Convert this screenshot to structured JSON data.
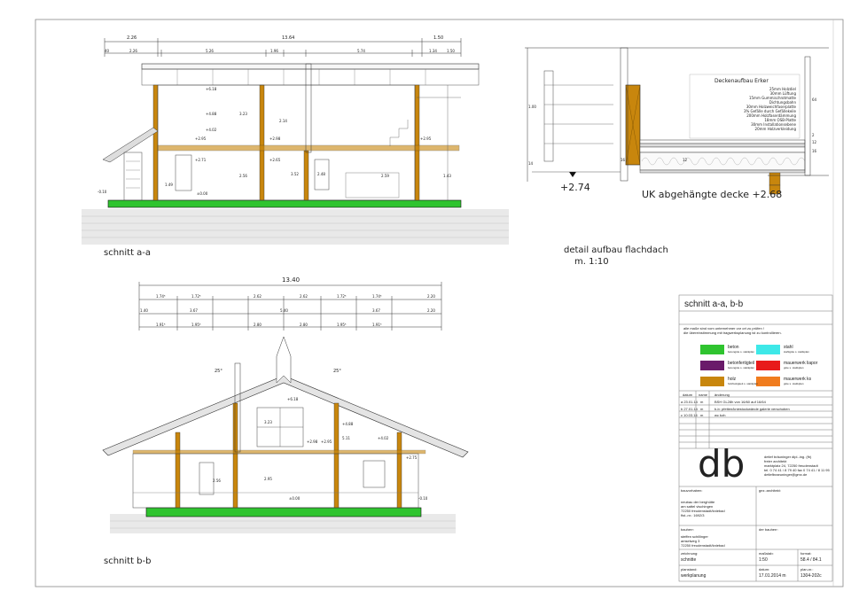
{
  "section_aa": {
    "label": "schnitt a-a",
    "dims_top": [
      "2.26",
      "13.64",
      "1.50"
    ],
    "dims_sub": [
      "40",
      "2.26",
      "16",
      "5.26",
      "16",
      "1.96",
      "16",
      "5.74",
      "16",
      "1.34",
      "16",
      "1.50"
    ],
    "levels": [
      "+6.18",
      "+4.88",
      "+4.02",
      "+2.95",
      "+2.71",
      "+2.98",
      "+2.65",
      "+2.95",
      "±0.00",
      "-0.10"
    ],
    "heights": [
      "3.23",
      "2.14",
      "2.56",
      "1.49",
      "3.52",
      "2.48",
      "2.59",
      "1.43"
    ]
  },
  "detail": {
    "label_line1": "detail aufbau flachdach",
    "label_line2": "m. 1:10",
    "elev_left": "+2.74",
    "elev_uk": "UK abgehängte decke +2.68",
    "build_up_title": "Deckenaufbau Erker",
    "build_up_lines": [
      "25mm Holzdiel",
      "30mm Lüftung",
      "15mm Gummischrotmatte",
      "Dichtungsbahn",
      "30mm Holzweichfaserplatte",
      "3% Gefälle durch Gefällekeile",
      "200mm Holzfaserdämmung",
      "18mm OSB-Platte",
      "30mm Installationsebene",
      "20mm Holzverkleidung"
    ],
    "dims": [
      "1.00",
      "64",
      "16",
      "14",
      "2",
      "12",
      "16",
      "12"
    ]
  },
  "section_bb": {
    "label": "schnitt b-b",
    "dim_total": "13.40",
    "dims_row1": [
      "16",
      "1.74⁵",
      "18",
      "1.72⁵",
      "18",
      "2.62",
      "18",
      "2.62",
      "18",
      "1.72⁵",
      "18",
      "1.74⁵",
      "16",
      "2.20"
    ],
    "dims_row2": [
      "1.40",
      "16",
      "3.67",
      "16",
      "5.40",
      "16",
      "3.67",
      "16",
      "2.20"
    ],
    "dims_row3": [
      "1.91⁵",
      "1.95⁵",
      "2.80",
      "2.80",
      "1.95⁵",
      "1.91⁵"
    ],
    "angles": [
      "25°",
      "25°"
    ],
    "levels": [
      "+6.18",
      "+4.88",
      "+4.02",
      "+2.98",
      "+2.95",
      "+2.75",
      "±0.00",
      "-0.10"
    ],
    "heights": [
      "3.23",
      "2.56",
      "2.95",
      "5.11"
    ]
  },
  "title_block": {
    "title": "schnitt a-a, b-b",
    "note_line1": "alle maße sind vom unternehmer vor ort zu prüfen !",
    "note_line2": "die übereinstimmung mit tragwerksplanung ist zu kontrollieren.",
    "legend": [
      {
        "name": "beton",
        "sub": "betongüte s. statikplan",
        "color": "#2fc42f"
      },
      {
        "name": "stahl",
        "sub": "stahlgüte s. statikplan",
        "color": "#3ee8e8"
      },
      {
        "name": "betonfertigteil",
        "sub": "betongüte s. statikplan",
        "color": "#6a1b6a"
      },
      {
        "name": "mauerwerk liapor",
        "sub": "güte s. statikplan",
        "color": "#e81b1b"
      },
      {
        "name": "holz",
        "sub": "holzfestigkeit s. statikplan",
        "color": "#c8860d"
      },
      {
        "name": "mauerwerk ks",
        "sub": "güte s. statikplan",
        "color": "#f07c1e"
      }
    ],
    "revision_headers": [
      "datum",
      "name",
      "änderung"
    ],
    "revisions": [
      [
        "a 23.01.14",
        "m",
        "BSH GL28h von 16/60 auf 16/64"
      ],
      [
        "b 27.01.14",
        "m",
        "b-b: pfetten/kniestockwände galerie verschoben"
      ],
      [
        "c 10.03.14",
        "m",
        "wc bzh"
      ]
    ],
    "logo": "db",
    "firm_lines": [
      "detlef bräuninger dipl.-ing. (fh)",
      "freier architekt",
      "marktplatz 24, 72250 freudenstadt",
      "tel. 0 74 41 / 8 79 40   fax 0 74 41 / 8 11 95",
      "detlefbraeuninger@gmx.de"
    ],
    "bauvorhaben_label": "bauvorhaben:",
    "genehmigt_label": "gez.:architekt:",
    "project_lines": [
      "neubau der berghütte",
      "am sattel vischingen",
      "72250 freudenstadt/kniebad",
      "flst.-nr.: 1692/3"
    ],
    "bauherr_label": "bauherr:",
    "bauherr_sign_label": "der bauherr:",
    "client_lines": [
      "steffen schillinger",
      "amselweg 3",
      "72250 freudenstadt/kniebad"
    ],
    "zeichnung_label": "zeichnung:",
    "zeichnung_value": "schnitte",
    "massstab_label": "maßstab:",
    "massstab_value": "1:50",
    "format_label": "format:",
    "format_value": "58.4 / 84.1",
    "planstand_label": "planstand:",
    "planstand_value": "werkplanung",
    "datum_label": "datum:",
    "datum_value": "17.01.2014 m",
    "plannr_label": "plan-nr.:",
    "plannr_value": "1304-202c"
  }
}
